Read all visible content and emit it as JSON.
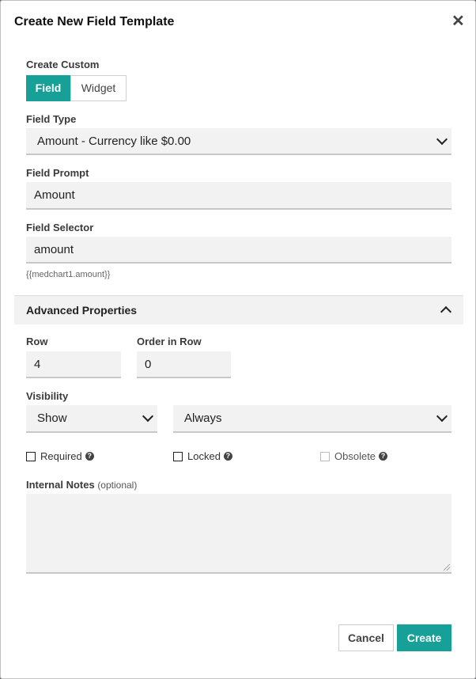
{
  "dialog": {
    "title": "Create New Field Template",
    "close_glyph": "✕"
  },
  "create_custom": {
    "label": "Create Custom",
    "options": [
      "Field",
      "Widget"
    ],
    "selected": "Field"
  },
  "field_type": {
    "label": "Field Type",
    "value": "Amount - Currency like $0.00"
  },
  "field_prompt": {
    "label": "Field Prompt",
    "value": "Amount"
  },
  "field_selector": {
    "label": "Field Selector",
    "value": "amount",
    "hint": "{{medchart1.amount}}"
  },
  "advanced": {
    "title": "Advanced Properties",
    "expanded": true,
    "row": {
      "label": "Row",
      "value": "4"
    },
    "order_in_row": {
      "label": "Order in Row",
      "value": "0"
    },
    "visibility": {
      "label": "Visibility",
      "mode": "Show",
      "condition": "Always"
    },
    "checkboxes": [
      {
        "label": "Required",
        "checked": false,
        "enabled": true
      },
      {
        "label": "Locked",
        "checked": false,
        "enabled": true
      },
      {
        "label": "Obsolete",
        "checked": false,
        "enabled": false
      }
    ],
    "internal_notes": {
      "label": "Internal Notes",
      "suffix": "(optional)",
      "value": ""
    }
  },
  "footer": {
    "cancel_label": "Cancel",
    "create_label": "Create"
  },
  "colors": {
    "accent": "#17a097"
  }
}
